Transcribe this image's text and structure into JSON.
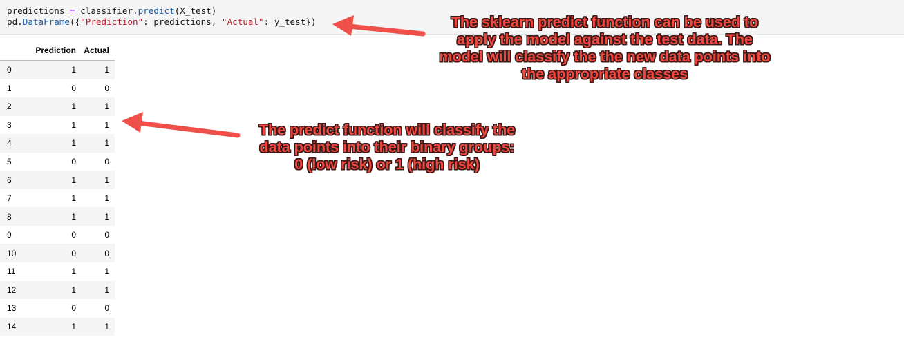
{
  "code": {
    "line1": {
      "var": "predictions ",
      "op": "=",
      "call_prefix": " classifier.",
      "fn": "predict",
      "args": "(X_test)"
    },
    "line2": {
      "obj": "pd.",
      "fn": "DataFrame",
      "open": "({",
      "key1": "\"Prediction\"",
      "mid": ": predictions, ",
      "key2": "\"Actual\"",
      "close": ": y_test})"
    }
  },
  "table": {
    "headers": [
      "",
      "Prediction",
      "Actual"
    ],
    "rows": [
      [
        "0",
        "1",
        "1"
      ],
      [
        "1",
        "0",
        "0"
      ],
      [
        "2",
        "1",
        "1"
      ],
      [
        "3",
        "1",
        "1"
      ],
      [
        "4",
        "1",
        "1"
      ],
      [
        "5",
        "0",
        "0"
      ],
      [
        "6",
        "1",
        "1"
      ],
      [
        "7",
        "1",
        "1"
      ],
      [
        "8",
        "1",
        "1"
      ],
      [
        "9",
        "0",
        "0"
      ],
      [
        "10",
        "0",
        "0"
      ],
      [
        "11",
        "1",
        "1"
      ],
      [
        "12",
        "1",
        "1"
      ],
      [
        "13",
        "0",
        "0"
      ],
      [
        "14",
        "1",
        "1"
      ]
    ]
  },
  "annotations": {
    "top": [
      "The sklearn predict function can be used to",
      "apply the model against the test data. The",
      "model will classify the the new data points into",
      "the appropriate classes"
    ],
    "middle": [
      "The predict function will classify the",
      "data points into their binary groups:",
      "0 (low risk) or 1 (high risk)"
    ]
  },
  "colors": {
    "annotation_fill": "#f2473f",
    "annotation_outline": "#3a1a18",
    "arrow": "#f0504a",
    "code_bg": "#f5f5f5",
    "zebra": "#f5f5f5"
  }
}
